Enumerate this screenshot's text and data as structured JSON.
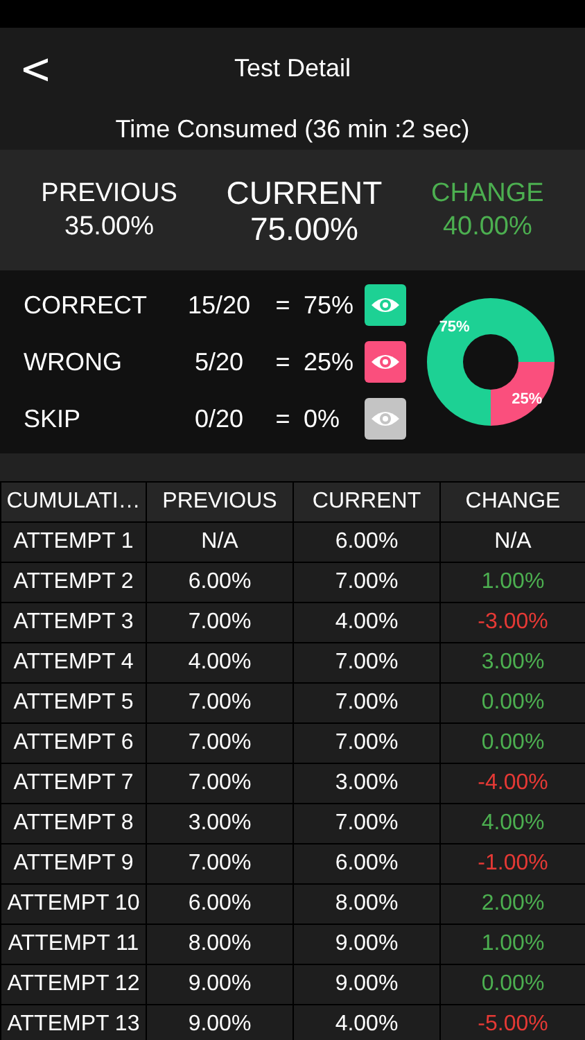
{
  "nav": {
    "back": "<",
    "title": "Test Detail"
  },
  "time_consumed": "Time Consumed (36 min :2 sec)",
  "summary": [
    {
      "kind": "previous",
      "label": "PREVIOUS",
      "value": "35.00%"
    },
    {
      "kind": "current",
      "label": "CURRENT",
      "value": "75.00%"
    },
    {
      "kind": "change",
      "label": "CHANGE",
      "value": "40.00%",
      "color": "#4caf50"
    }
  ],
  "stats": [
    {
      "label": "CORRECT",
      "fraction": "15/20",
      "equals": "=",
      "percent": "75%",
      "color": "#1dd194"
    },
    {
      "label": "WRONG",
      "fraction": "5/20",
      "equals": "=",
      "percent": "25%",
      "color": "#fa4f7d"
    },
    {
      "label": "SKIP",
      "fraction": "0/20",
      "equals": "=",
      "percent": "0%",
      "color": "#c4c4c4"
    }
  ],
  "chart_data": {
    "type": "donut",
    "values": [
      75,
      25
    ],
    "value_labels": [
      "75%",
      "25%"
    ]
  },
  "table": {
    "columns": [
      "CUMULATI…",
      "PREVIOUS",
      "CURRENT",
      "CHANGE"
    ],
    "rows": [
      {
        "attempt": "ATTEMPT 1",
        "previous": "N/A",
        "current": "6.00%",
        "change": "N/A",
        "kind": "blank"
      },
      {
        "attempt": "ATTEMPT 2",
        "previous": "6.00%",
        "current": "7.00%",
        "change": "1.00%",
        "kind": "gain"
      },
      {
        "attempt": "ATTEMPT 3",
        "previous": "7.00%",
        "current": "4.00%",
        "change": "-3.00%",
        "kind": "loss"
      },
      {
        "attempt": "ATTEMPT 4",
        "previous": "4.00%",
        "current": "7.00%",
        "change": "3.00%",
        "kind": "gain"
      },
      {
        "attempt": "ATTEMPT 5",
        "previous": "7.00%",
        "current": "7.00%",
        "change": "0.00%",
        "kind": "gain"
      },
      {
        "attempt": "ATTEMPT 6",
        "previous": "7.00%",
        "current": "7.00%",
        "change": "0.00%",
        "kind": "gain"
      },
      {
        "attempt": "ATTEMPT 7",
        "previous": "7.00%",
        "current": "3.00%",
        "change": "-4.00%",
        "kind": "loss"
      },
      {
        "attempt": "ATTEMPT 8",
        "previous": "3.00%",
        "current": "7.00%",
        "change": "4.00%",
        "kind": "gain"
      },
      {
        "attempt": "ATTEMPT 9",
        "previous": "7.00%",
        "current": "6.00%",
        "change": "-1.00%",
        "kind": "loss"
      },
      {
        "attempt": "ATTEMPT 10",
        "previous": "6.00%",
        "current": "8.00%",
        "change": "2.00%",
        "kind": "gain"
      },
      {
        "attempt": "ATTEMPT 11",
        "previous": "8.00%",
        "current": "9.00%",
        "change": "1.00%",
        "kind": "gain"
      },
      {
        "attempt": "ATTEMPT 12",
        "previous": "9.00%",
        "current": "9.00%",
        "change": "0.00%",
        "kind": "gain"
      },
      {
        "attempt": "ATTEMPT 13",
        "previous": "9.00%",
        "current": "4.00%",
        "change": "-5.00%",
        "kind": "loss"
      }
    ]
  }
}
